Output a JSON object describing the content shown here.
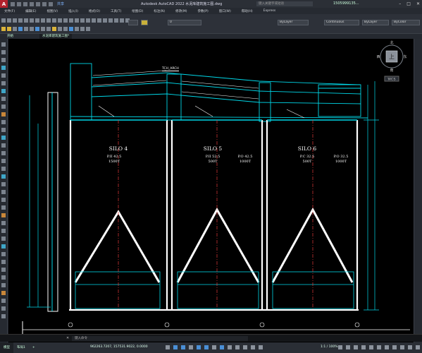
{
  "app": {
    "title": "Autodesk AutoCAD 2022    水泥库建筑施工图.dwg",
    "share_label": "共享",
    "search_placeholder": "键入关键字或短语",
    "user": "1505999135..."
  },
  "menu": [
    "文件(F)",
    "编辑(E)",
    "视图(V)",
    "插入(I)",
    "格式(O)",
    "工具(T)",
    "绘图(D)",
    "标注(N)",
    "修改(M)",
    "参数(P)",
    "窗口(W)",
    "帮助(H)",
    "Express"
  ],
  "toolbar": {
    "layer_value": "0",
    "color_value": "ByLayer",
    "linetype_value": "Continuous",
    "lineweight_value": "ByLayer",
    "plotstyle_value": "ByColor"
  },
  "file_tabs": [
    {
      "label": "开始"
    },
    {
      "label": "水泥库建筑施工图*"
    }
  ],
  "drawing": {
    "tab_label": "TCH_ARCH",
    "silos": [
      {
        "name": "SILO 4",
        "spec1": "P.II 42.5",
        "spec2": "1500T",
        "spec3": "",
        "spec4": ""
      },
      {
        "name": "SILO 5",
        "spec1": "P.II 52.5",
        "spec2": "500T",
        "spec3": "P.O 42.5",
        "spec4": "1000T"
      },
      {
        "name": "SILO 6",
        "spec1": "P.C 32.5",
        "spec2": "500T",
        "spec3": "P.O 32.5",
        "spec4": "1000T"
      }
    ]
  },
  "viewcube": {
    "north": "北",
    "south": "南",
    "east": "东",
    "west": "西",
    "top": "上",
    "wcs": "WCS"
  },
  "command": {
    "placeholder": "键入命令"
  },
  "status": {
    "tabs": [
      "模型",
      "布局1"
    ],
    "coords": "962263.7207, 157531.9022, 0.0000",
    "model_label": "模型",
    "scale": "1:1 / 100%"
  },
  "colors": {
    "background": "#000000",
    "structure": "#ffffff",
    "accent": "#00d7e8",
    "centerline": "#e23a3a"
  }
}
